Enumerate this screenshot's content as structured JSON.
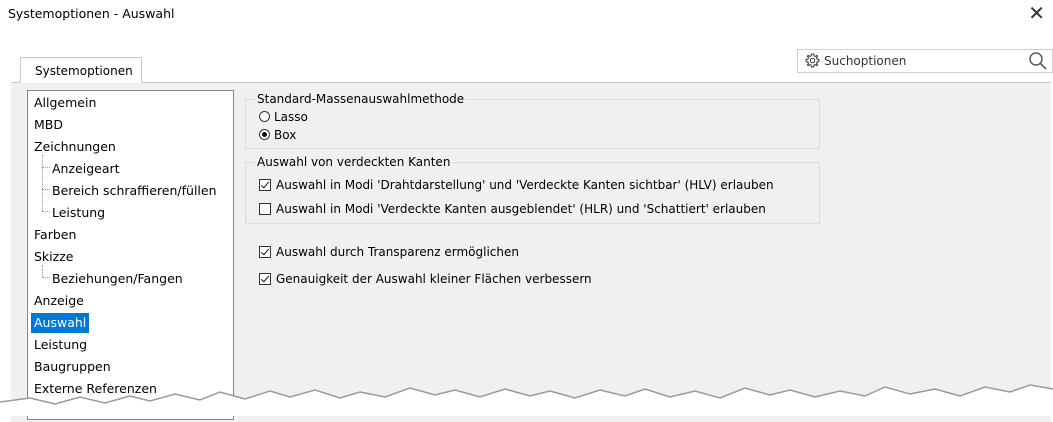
{
  "window": {
    "title": "Systemoptionen - Auswahl",
    "close_glyph": "✕"
  },
  "tabs": [
    {
      "label": "Systemoptionen",
      "active": true
    }
  ],
  "search": {
    "placeholder": "Suchoptionen",
    "value": ""
  },
  "tree": {
    "items": [
      {
        "label": "Allgemein",
        "level": 0
      },
      {
        "label": "MBD",
        "level": 0
      },
      {
        "label": "Zeichnungen",
        "level": 0
      },
      {
        "label": "Anzeigeart",
        "level": 1
      },
      {
        "label": "Bereich schraffieren/füllen",
        "level": 1
      },
      {
        "label": "Leistung",
        "level": 1
      },
      {
        "label": "Farben",
        "level": 0
      },
      {
        "label": "Skizze",
        "level": 0
      },
      {
        "label": "Beziehungen/Fangen",
        "level": 1
      },
      {
        "label": "Anzeige",
        "level": 0
      },
      {
        "label": "Auswahl",
        "level": 0,
        "selected": true
      },
      {
        "label": "Leistung",
        "level": 0
      },
      {
        "label": "Baugruppen",
        "level": 0
      },
      {
        "label": "Externe Referenzen",
        "level": 0
      }
    ]
  },
  "mass_selection": {
    "title": "Standard-Massenauswahlmethode",
    "options": [
      {
        "label": "Lasso",
        "selected": false
      },
      {
        "label": "Box",
        "selected": true
      }
    ]
  },
  "hidden_edges": {
    "title": "Auswahl von verdeckten Kanten",
    "options": [
      {
        "label": "Auswahl in Modi 'Drahtdarstellung' und 'Verdeckte Kanten sichtbar' (HLV) erlauben",
        "checked": true
      },
      {
        "label": "Auswahl in Modi 'Verdeckte Kanten ausgeblendet' (HLR) und 'Schattiert' erlauben",
        "checked": false
      }
    ]
  },
  "extra_options": [
    {
      "label": "Auswahl durch Transparenz ermöglichen",
      "checked": true
    },
    {
      "label": "Genauigkeit der Auswahl kleiner Flächen verbessern",
      "checked": true
    }
  ],
  "icons": {
    "settings": "gear-icon",
    "search": "magnifier-icon",
    "close": "close-icon"
  },
  "colors": {
    "selection": "#0078d7",
    "panel": "#f0f0f0"
  }
}
